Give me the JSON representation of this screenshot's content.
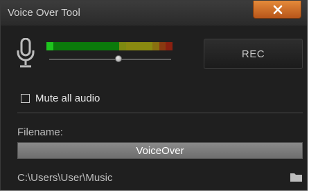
{
  "window": {
    "title": "Voice Over Tool",
    "close_icon": "close-x-icon"
  },
  "recorder": {
    "mic_icon": "microphone-icon",
    "level_meter": {
      "segments": [
        {
          "color": "#1ec41e"
        },
        {
          "color": "#0b7a0b"
        },
        {
          "color": "#0b7a0b"
        },
        {
          "color": "#0b7a0b"
        },
        {
          "color": "#0b7a0b"
        },
        {
          "color": "#0b7a0b"
        },
        {
          "color": "#0b7a0b"
        },
        {
          "color": "#0b7a0b"
        },
        {
          "color": "#0b7a0b"
        },
        {
          "color": "#0b7a0b"
        },
        {
          "color": "#0b7a0b"
        },
        {
          "color": "#7e8a10"
        },
        {
          "color": "#8a8a10"
        },
        {
          "color": "#8a8a10"
        },
        {
          "color": "#8a8a10"
        },
        {
          "color": "#8a8a10"
        },
        {
          "color": "#8a7010"
        },
        {
          "color": "#8a3a10"
        },
        {
          "color": "#8a2010"
        }
      ]
    },
    "volume_level": 0.57,
    "rec_label": "REC"
  },
  "options": {
    "mute_label": "Mute all audio",
    "mute_checked": false
  },
  "file": {
    "filename_label": "Filename:",
    "filename_value": "VoiceOver",
    "path": "C:\\Users\\User\\Music",
    "folder_icon": "folder-icon"
  },
  "colors": {
    "accent_close": "#d8732b",
    "background": "#1f1f1f",
    "text": "#bdbdbd"
  }
}
